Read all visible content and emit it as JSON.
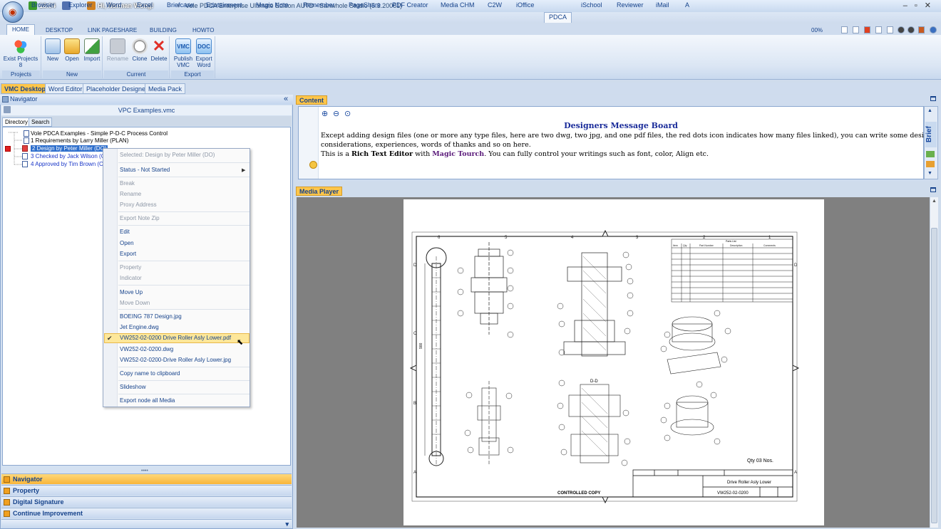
{
  "titlebar": {
    "time": "18:04",
    "user": "Hi, Norman Wong!",
    "title": "Vole PDCA Enterprise Ultimate Edition AUTD - Sanwhole Studio (5.3.20061)"
  },
  "top_menu": [
    "Browser",
    "Explorer",
    "Word",
    "Excel",
    "Briefcase",
    "Edutainment",
    "Magic Note",
    "Remember",
    "PageShare",
    "PDF Creator",
    "Media CHM",
    "C2W",
    "iOffice",
    "PDCA",
    "iSchool",
    "Reviewer",
    "iMail",
    "A"
  ],
  "top_menu_selected": "PDCA",
  "ribbon_tabs": [
    "HOME",
    "DESKTOP",
    "LINK PAGESHARE",
    "BUILDING",
    "HOWTO"
  ],
  "ribbon_tab_selected": "HOME",
  "zoom": "00%",
  "ribbon": {
    "projects": {
      "label": "Projects",
      "exist": "Exist Projects",
      "count": "8"
    },
    "new": {
      "label": "New",
      "new": "New",
      "open": "Open",
      "import": "Import"
    },
    "current": {
      "label": "Current",
      "rename": "Rename",
      "clone": "Clone",
      "delete": "Delete"
    },
    "export": {
      "label": "Export",
      "publish": "Publish",
      "publish2": "VMC",
      "export": "Export",
      "export2": "Word",
      "vmc_icon": "VMC",
      "doc_icon": "DOC"
    }
  },
  "doc_tabs": [
    "VMC Desktop",
    "Word Editor",
    "Placeholder Designer",
    "Media Pack"
  ],
  "doc_tab_selected": "VMC Desktop",
  "navigator": {
    "title": "Navigator",
    "file": "VPC Examples.vmc",
    "tabs": [
      "Directory",
      "Search"
    ],
    "tree": [
      {
        "text": "Vole PDCA Examples - Simple P-D-C Process Control"
      },
      {
        "text": "1 Requirements by Larry Miller (PLAN)"
      },
      {
        "text": "2 Design by Peter Miller (DO)"
      },
      {
        "text": "3 Checked by Jack Wilson (CH"
      },
      {
        "text": "4 Approved by Tim Brown (CH"
      }
    ],
    "accordion": [
      "Navigator",
      "Property",
      "Digital Signature",
      "Continue Improvement"
    ]
  },
  "context_menu": {
    "items": [
      "Selected: Design by Peter Miller (DO)",
      "Status - Not Started",
      "Break",
      "Rename",
      "Proxy Address",
      "Export Note Zip",
      "Edit",
      "Open",
      "Export",
      "Property",
      "Indicator",
      "Move Up",
      "Move Down",
      "BOEING 787 Design.jpg",
      "Jet Engine.dwg",
      "VW252-02-0200 Drive Roller Asly Lower.pdf",
      "VW252-02-0200.dwg",
      "VW252-02-0200-Drive Roller Asly Lower.jpg",
      "Copy name to clipboard",
      "Slideshow",
      "Export node all Media"
    ],
    "checked": "VW252-02-0200 Drive Roller Asly Lower.pdf"
  },
  "content": {
    "label": "Content",
    "title": "Designers Message Board",
    "line1": "Except adding design files (one or more any type files, here are two dwg, two jpg, and one pdf files, the red dots icon indicates how many files linked), you can write some design",
    "line2": "considerations, experiences, words of thanks and so on here.",
    "line3_a": "This is a ",
    "line3_b": "Rich Text Editor",
    "line3_c": " with ",
    "line3_d": "Magic Tourch",
    "line3_e": ". You can fully control your writings such as font, color, Align etc.",
    "side_label": "Brief"
  },
  "media_player": {
    "label": "Media Player",
    "drawing": {
      "controlled": "CONTROLLED COPY",
      "qty": "Qty  03 Nos.",
      "title": "Drive Roller Asly Lower",
      "number": "VW252-02-0200",
      "section1": "D-D",
      "col_nos": [
        "6",
        "5",
        "4",
        "3",
        "2",
        "1"
      ],
      "row_letters": [
        "D",
        "C",
        "B",
        "A"
      ],
      "parts_header": [
        "Item",
        "Qty",
        "Part Number",
        "Description",
        "Comments"
      ],
      "bom_title": "Parts List",
      "dimension": "900"
    }
  },
  "colors": {
    "accent": "#ffc64a",
    "selection": "#2f6fcc",
    "link": "#1936c8",
    "title_blue": "#1a2c9a"
  }
}
